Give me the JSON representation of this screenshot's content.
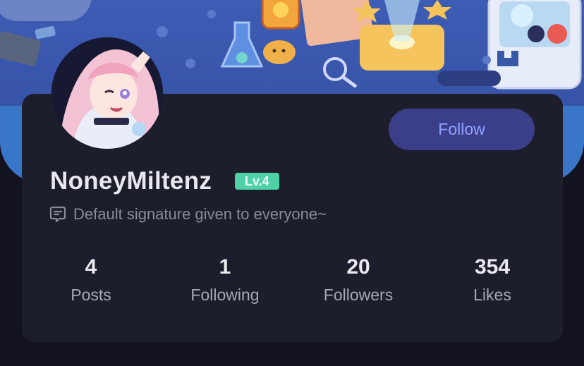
{
  "profile": {
    "username": "NoneyMiltenz",
    "level": "Lv.4",
    "signature": "Default signature given to everyone~",
    "follow_label": "Follow"
  },
  "stats": [
    {
      "value": "4",
      "label": "Posts"
    },
    {
      "value": "1",
      "label": "Following"
    },
    {
      "value": "20",
      "label": "Followers"
    },
    {
      "value": "354",
      "label": "Likes"
    }
  ],
  "icons": {
    "signature": "chat-bubble-icon"
  },
  "colors": {
    "background": "#12131f",
    "card": "#1d1e2b",
    "banner": "#3d5cb4",
    "follow_button": "#3b3f8a",
    "follow_text": "#8fa0ff",
    "level_badge": "#4fd1a7"
  }
}
